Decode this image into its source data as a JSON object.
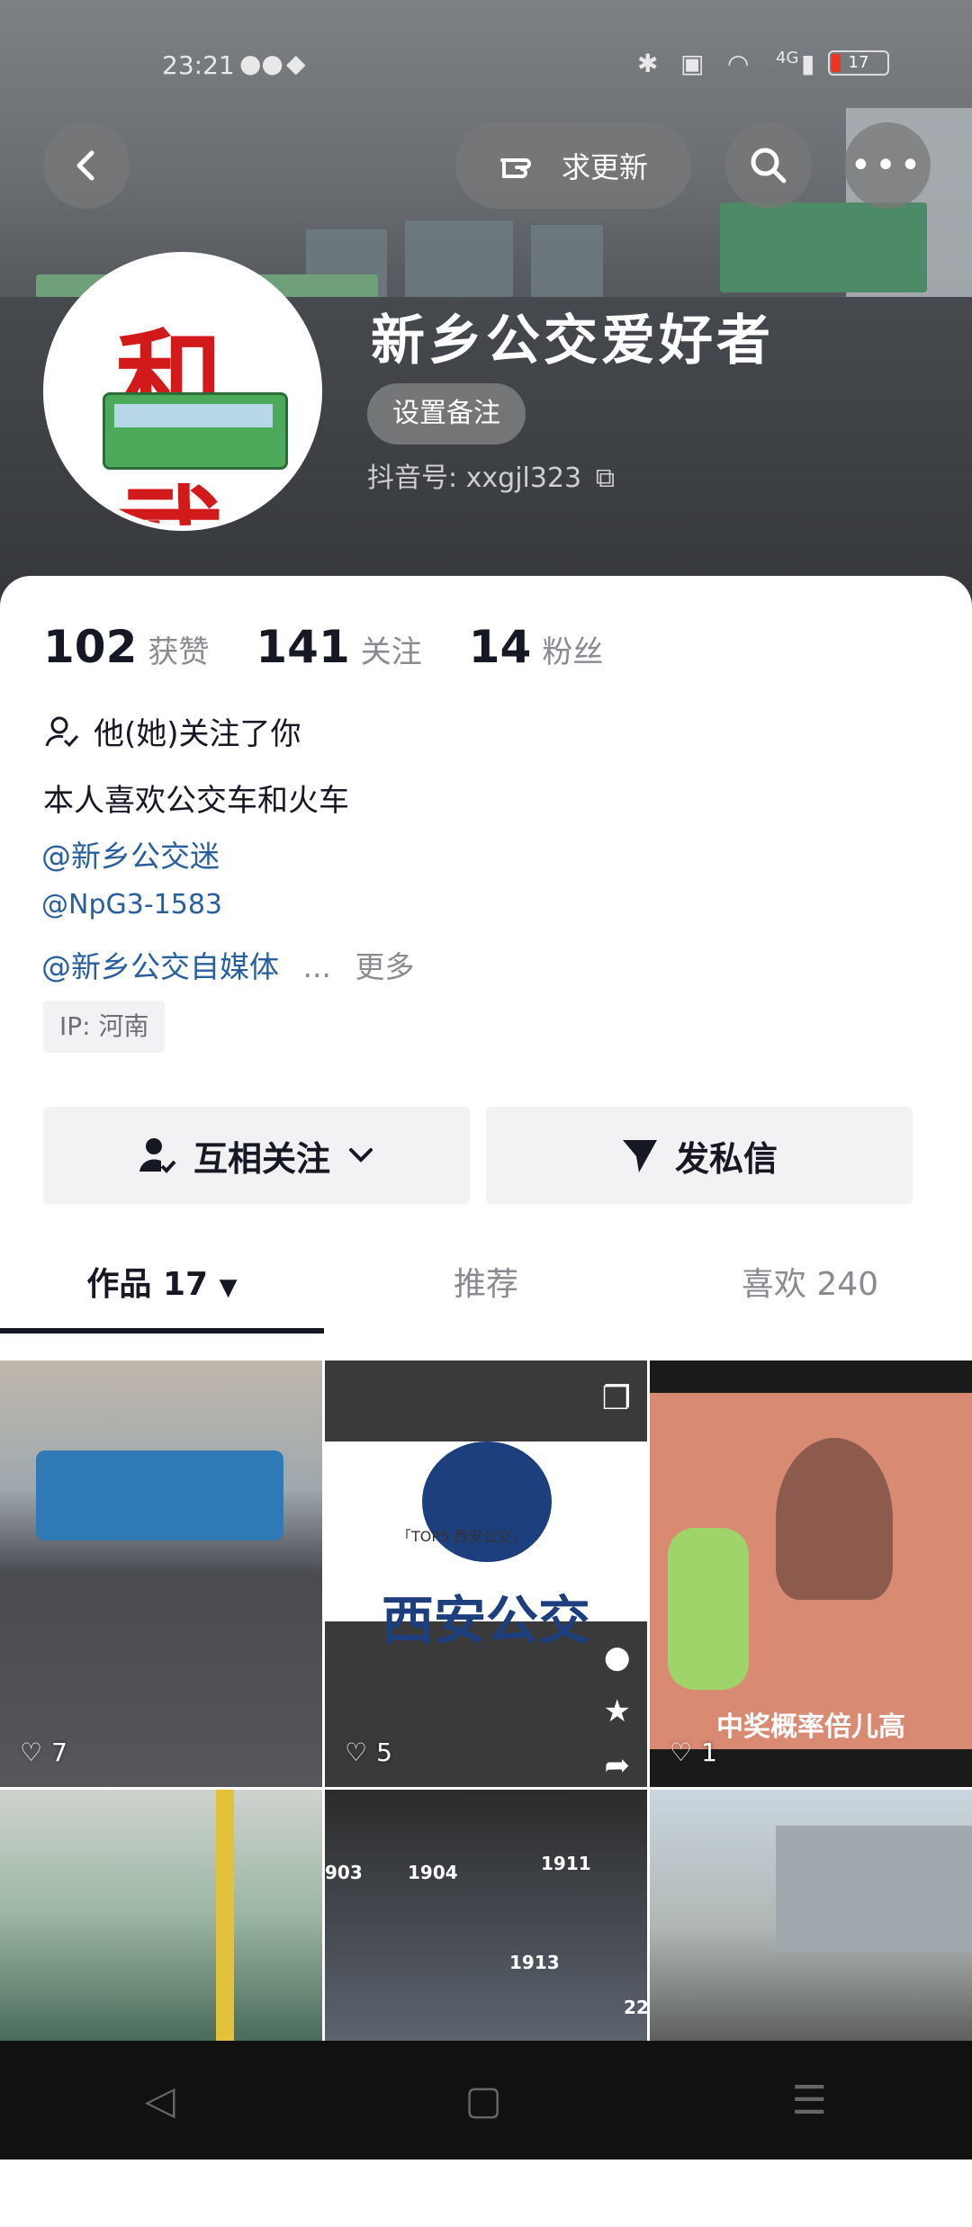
{
  "status_bar": {
    "time": "23:21",
    "battery": "17",
    "network": "4G"
  },
  "header": {
    "back_icon": "chevron-left-icon",
    "request_update": "求更新",
    "username": "新乡公交爱好者",
    "set_remark": "设置备注",
    "douyin_id_label": "抖音号:",
    "douyin_id": "xxgjl323"
  },
  "stats": {
    "likes_count": "102",
    "likes_label": "获赞",
    "following_count": "141",
    "following_label": "关注",
    "fans_count": "14",
    "fans_label": "粉丝"
  },
  "profile": {
    "followed_you": "他(她)关注了你",
    "bio": "本人喜欢公交车和火车",
    "mentions": [
      "@新乡公交迷",
      "@NpG3-1583",
      "@新乡公交自媒体"
    ],
    "ellipsis": "...",
    "more": "更多",
    "ip": "IP: 河南"
  },
  "actions": {
    "mutual_follow": "互相关注",
    "send_message": "发私信"
  },
  "tabs": {
    "works": "作品 17",
    "recommend": "推荐",
    "liked": "喜欢 240"
  },
  "videos": [
    {
      "likes": "7"
    },
    {
      "likes": "5",
      "title": "西安公交",
      "subtitle": "「TOP5 西安公交」"
    },
    {
      "likes": "1",
      "caption": "中奖概率倍儿高"
    },
    {
      "likes": ""
    },
    {
      "likes": "",
      "labels": [
        "903",
        "1904",
        "1911",
        "1913",
        "22"
      ]
    },
    {
      "likes": ""
    }
  ],
  "colors": {
    "accent_link": "#2a5f9e",
    "text_primary": "#161823",
    "text_secondary": "#8a8b91"
  }
}
